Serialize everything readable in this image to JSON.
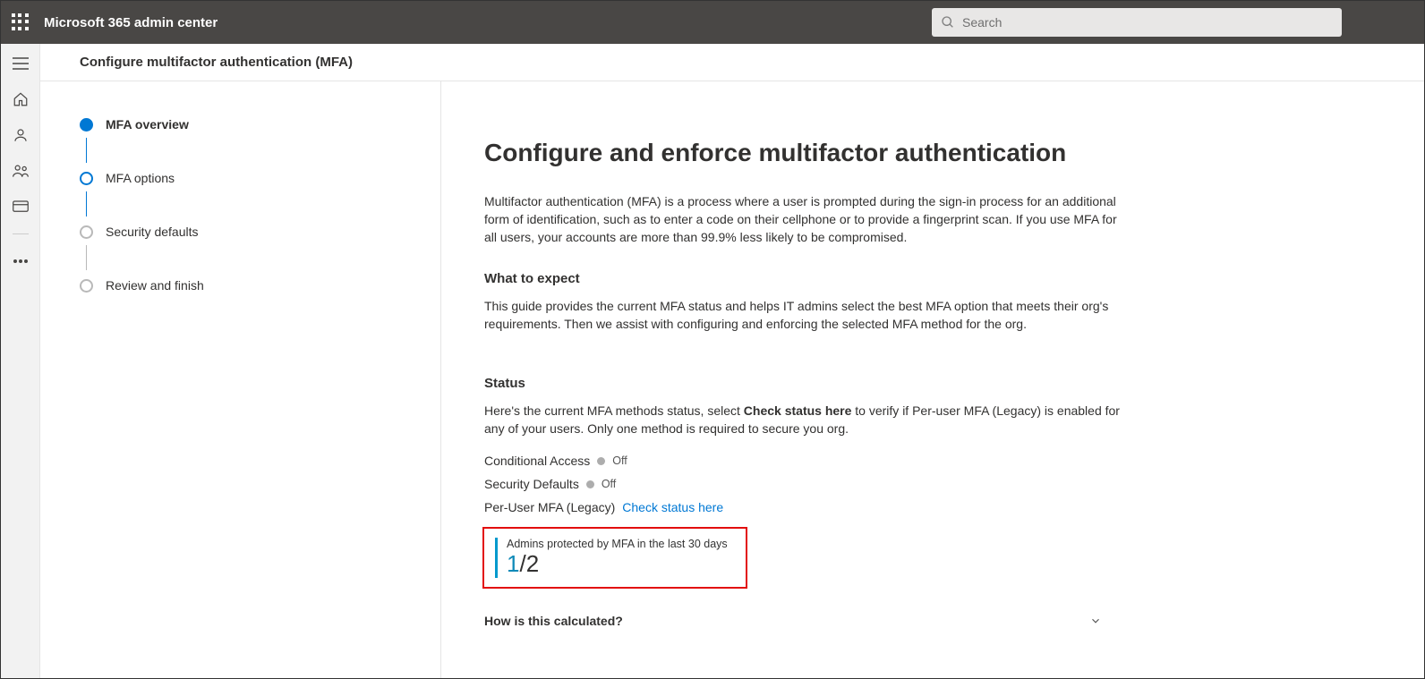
{
  "header": {
    "app_title": "Microsoft 365 admin center",
    "search_placeholder": "Search"
  },
  "breadcrumb": "Configure multifactor authentication (MFA)",
  "steps": [
    {
      "label": "MFA overview",
      "state": "active"
    },
    {
      "label": "MFA options",
      "state": "next"
    },
    {
      "label": "Security defaults",
      "state": "inactive"
    },
    {
      "label": "Review and finish",
      "state": "inactive"
    }
  ],
  "content": {
    "title": "Configure and enforce multifactor authentication",
    "intro": "Multifactor authentication (MFA) is a process where a user is prompted during the sign-in process for an additional form of identification, such as to enter a code on their cellphone or to provide a fingerprint scan. If you use MFA for all users, your accounts are more than 99.9% less likely to be compromised.",
    "expect_heading": "What to expect",
    "expect_body": "This guide provides the current MFA status and helps IT admins select the best MFA option that meets their org's requirements. Then we assist with configuring and enforcing the selected MFA method for the org.",
    "status_heading": "Status",
    "status_body_pre": "Here's the current MFA methods status, select ",
    "status_body_bold": "Check status here",
    "status_body_post": " to verify if Per-user MFA (Legacy) is enabled for any of your users. Only one method is required to secure you org.",
    "rows": {
      "ca_label": "Conditional Access",
      "ca_value": "Off",
      "sd_label": "Security Defaults",
      "sd_value": "Off",
      "pu_label": "Per-User MFA (Legacy)",
      "pu_link": "Check status here"
    },
    "callout": {
      "sub": "Admins protected by MFA in the last 30 days",
      "numerator": "1",
      "sep_denominator": "/2"
    },
    "expander": "How is this calculated?"
  }
}
